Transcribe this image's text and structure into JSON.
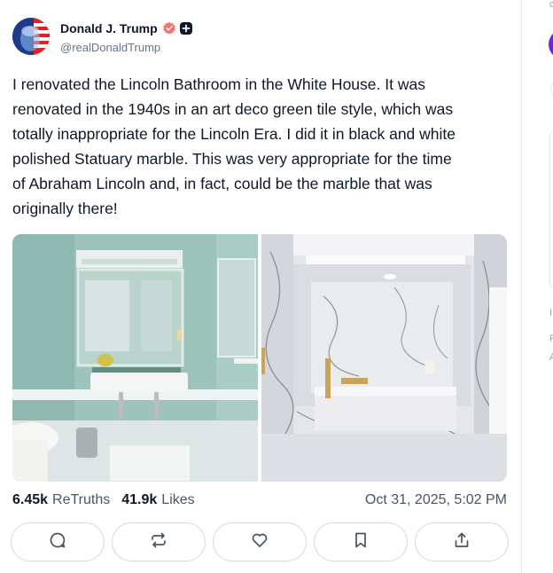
{
  "post": {
    "author": {
      "display_name": "Donald J. Trump",
      "handle": "@realDonaldTrump",
      "verified": true
    },
    "text": "I renovated the Lincoln Bathroom in the White House. It was\nrenovated in the 1940s in an art deco green tile style, which was\ntotally inappropriate for the Lincoln Era. I did it in black and white\npolished Statuary marble. This was very appropriate for the time\nof Abraham Lincoln and, in fact, could be the marble that was\noriginally there!",
    "stats": {
      "retruths_count": "6.45k",
      "retruths_label": "ReTruths",
      "likes_count": "41.9k",
      "likes_label": "Likes"
    },
    "timestamp": "Oct 31, 2025, 5:02 PM",
    "actions": [
      "reply-icon",
      "retruth-icon",
      "heart-icon",
      "bookmark-icon",
      "share-icon"
    ]
  },
  "colors": {
    "verified_badge": "#ef4444",
    "text_primary": "#0f172a",
    "text_secondary": "#64748b",
    "button_border": "#d4d8de",
    "sidebar_accent": "#6d28d9"
  },
  "sidebar": {
    "fragments": [
      "c",
      "I",
      "F",
      "A"
    ]
  }
}
